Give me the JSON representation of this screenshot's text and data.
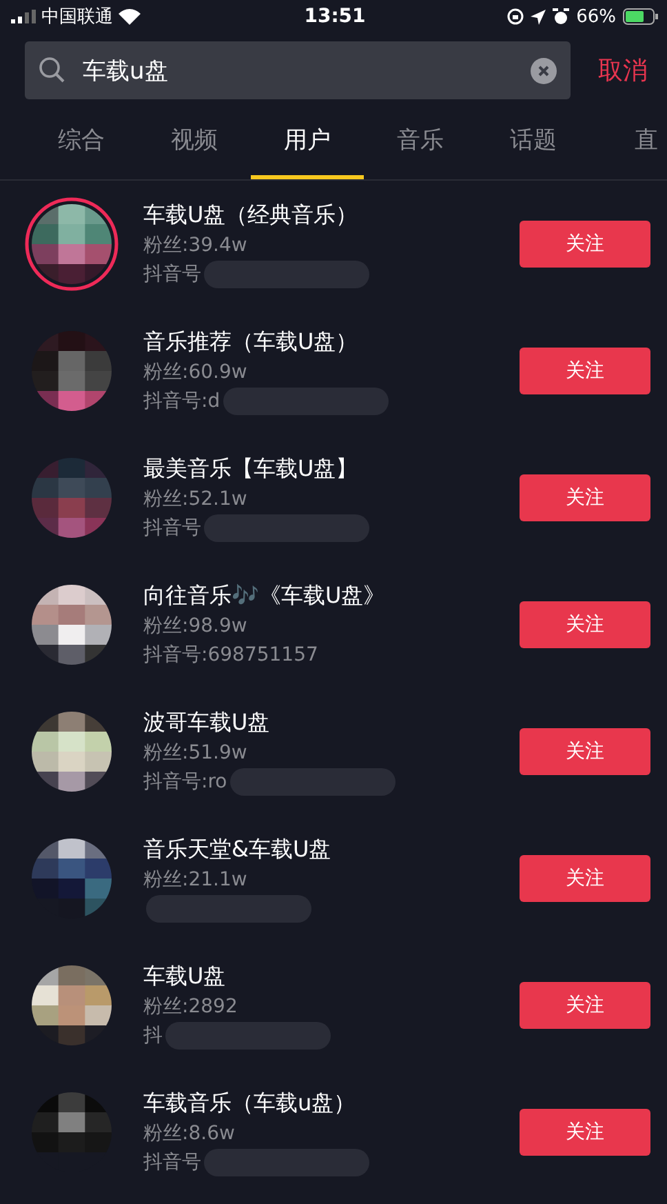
{
  "status_bar": {
    "carrier": "中国联通",
    "time": "13:51",
    "battery": "66%"
  },
  "search": {
    "value": "车载u盘",
    "cancel": "取消"
  },
  "tabs": [
    {
      "label": "综合",
      "selected": false
    },
    {
      "label": "视频",
      "selected": false
    },
    {
      "label": "用户",
      "selected": true
    },
    {
      "label": "音乐",
      "selected": false
    },
    {
      "label": "话题",
      "selected": false
    },
    {
      "label": "直",
      "selected": false
    }
  ],
  "users": [
    {
      "name": "车载U盘（经典音乐）",
      "fans": "粉丝:39.4w",
      "account": "抖音号",
      "redacted": true,
      "live": true,
      "button": "关注"
    },
    {
      "name": "音乐推荐（车载U盘）",
      "fans": "粉丝:60.9w",
      "account": "抖音号:d",
      "redacted": true,
      "live": false,
      "button": "关注"
    },
    {
      "name": "最美音乐【车载U盘】",
      "fans": "粉丝:52.1w",
      "account": "抖音号",
      "redacted": true,
      "live": false,
      "button": "关注"
    },
    {
      "name": "向往音乐🎶《车载U盘》",
      "fans": "粉丝:98.9w",
      "account": "抖音号:698751157",
      "redacted": false,
      "live": false,
      "button": "关注"
    },
    {
      "name": "波哥车载U盘",
      "fans": "粉丝:51.9w",
      "account": "抖音号:ro",
      "redacted": true,
      "live": false,
      "button": "关注"
    },
    {
      "name": "音乐天堂&车载U盘",
      "fans": "粉丝:21.1w",
      "redacted": true,
      "live": false,
      "button": "关注"
    },
    {
      "name": "车载U盘",
      "fans": "粉丝:2892",
      "account": "抖",
      "redacted": true,
      "live": false,
      "button": "关注"
    },
    {
      "name": "车载音乐（车载u盘）",
      "fans": "粉丝:8.6w",
      "account": "抖音号",
      "redacted": true,
      "live": false,
      "button": "关注"
    }
  ]
}
